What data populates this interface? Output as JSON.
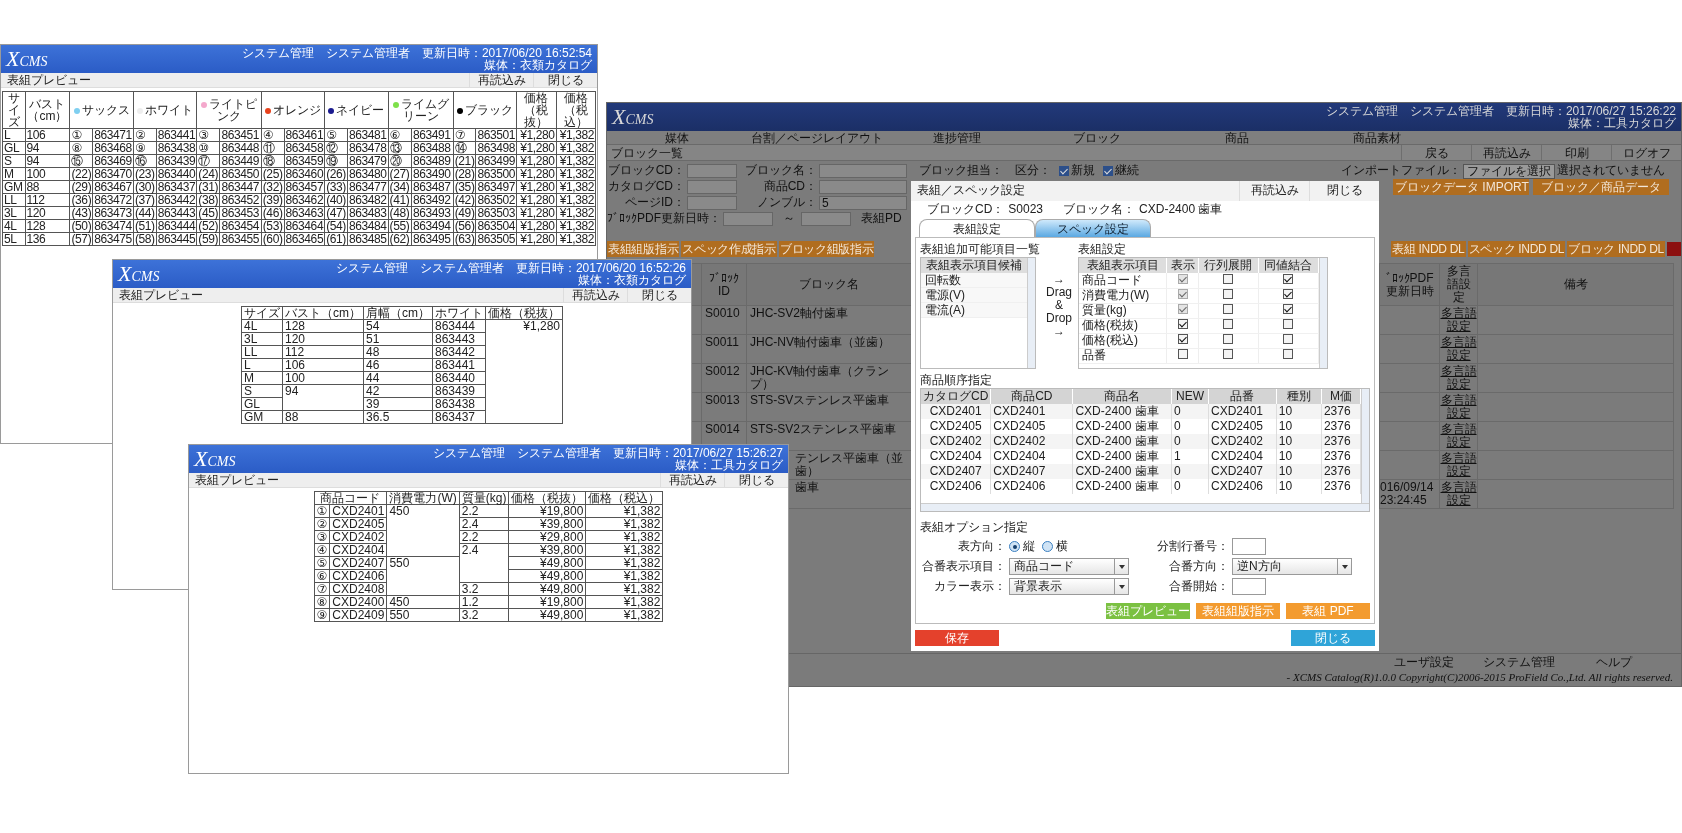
{
  "preview_windows": [
    {
      "logo": "XCMS",
      "header_info": "システム管理　システム管理者　更新日時：2017/06/20 16:52:54",
      "media": "媒体：衣類カタログ",
      "title": "表組プレビュー",
      "buttons": [
        "再読込み",
        "閉じる"
      ],
      "table": {
        "header": [
          {
            "text": "サイズ",
            "kind": "plain"
          },
          {
            "text": "バスト（cm）",
            "kind": "plain"
          },
          {
            "text": "サックス",
            "color": "#7fcff0",
            "kind": "marked"
          },
          {
            "text": "ホワイト",
            "color": "#eeeeee",
            "kind": "marked"
          },
          {
            "text": "ライトピンク",
            "color": "#f4a8cc",
            "kind": "marked"
          },
          {
            "text": "オレンジ",
            "color": "#e8421c",
            "kind": "marked"
          },
          {
            "text": "ネイビー",
            "color": "#1b1b8f",
            "kind": "marked"
          },
          {
            "text": "ライムグリーン",
            "color": "#7ee04a",
            "kind": "marked"
          },
          {
            "text": "ブラック",
            "color": "#000000",
            "kind": "marked"
          },
          {
            "text": "価格（税抜）",
            "kind": "price"
          },
          {
            "text": "価格（税込）",
            "kind": "price"
          }
        ],
        "rows": [
          [
            "L",
            "106",
            "①",
            "863471",
            "②",
            "863441",
            "③",
            "863451",
            "④",
            "863461",
            "⑤",
            "863481",
            "⑥",
            "863491",
            "⑦",
            "863501",
            "¥1,280",
            "¥1,382"
          ],
          [
            "GL",
            "94",
            "⑧",
            "863468",
            "⑨",
            "863438",
            "⑩",
            "863448",
            "⑪",
            "863458",
            "⑫",
            "863478",
            "⑬",
            "863488",
            "⑭",
            "863498",
            "¥1,280",
            "¥1,382"
          ],
          [
            "S",
            "94",
            "⑮",
            "863469",
            "⑯",
            "863439",
            "⑰",
            "863449",
            "⑱",
            "863459",
            "⑲",
            "863479",
            "⑳",
            "863489",
            "(21)",
            "863499",
            "¥1,280",
            "¥1,382"
          ],
          [
            "M",
            "100",
            "(22)",
            "863470",
            "(23)",
            "863440",
            "(24)",
            "863450",
            "(25)",
            "863460",
            "(26)",
            "863480",
            "(27)",
            "863490",
            "(28)",
            "863500",
            "¥1,280",
            "¥1,382"
          ],
          [
            "GM",
            "88",
            "(29)",
            "863467",
            "(30)",
            "863437",
            "(31)",
            "863447",
            "(32)",
            "863457",
            "(33)",
            "863477",
            "(34)",
            "863487",
            "(35)",
            "863497",
            "¥1,280",
            "¥1,382"
          ],
          [
            "LL",
            "112",
            "(36)",
            "863472",
            "(37)",
            "863442",
            "(38)",
            "863452",
            "(39)",
            "863462",
            "(40)",
            "863482",
            "(41)",
            "863492",
            "(42)",
            "863502",
            "¥1,280",
            "¥1,382"
          ],
          [
            "3L",
            "120",
            "(43)",
            "863473",
            "(44)",
            "863443",
            "(45)",
            "863453",
            "(46)",
            "863463",
            "(47)",
            "863483",
            "(48)",
            "863493",
            "(49)",
            "863503",
            "¥1,280",
            "¥1,382"
          ],
          [
            "4L",
            "128",
            "(50)",
            "863474",
            "(51)",
            "863444",
            "(52)",
            "863454",
            "(53)",
            "863464",
            "(54)",
            "863484",
            "(55)",
            "863494",
            "(56)",
            "863504",
            "¥1,280",
            "¥1,382"
          ],
          [
            "5L",
            "136",
            "(57)",
            "863475",
            "(58)",
            "863445",
            "(59)",
            "863455",
            "(60)",
            "863465",
            "(61)",
            "863485",
            "(62)",
            "863495",
            "(63)",
            "863505",
            "¥1,280",
            "¥1,382"
          ]
        ]
      }
    },
    {
      "logo": "XCMS",
      "header_info": "システム管理　システム管理者　更新日時：2017/06/20 16:52:26",
      "media": "媒体：衣類カタログ",
      "title": "表組プレビュー",
      "buttons": [
        "再読込み",
        "閉じる"
      ],
      "table": {
        "header": [
          {
            "text": "サイズ",
            "kind": "plain"
          },
          {
            "text": "バスト（cm）",
            "kind": "plain"
          },
          {
            "text": "肩幅（cm）",
            "kind": "plain"
          },
          {
            "text": "ホワイト",
            "kind": "plain"
          },
          {
            "text": "価格（税抜）",
            "kind": "price"
          }
        ],
        "rows": [
          [
            "4L",
            "128",
            "54",
            "863444",
            "¥1,280"
          ],
          [
            "3L",
            "120",
            "51",
            "863443",
            null
          ],
          [
            "LL",
            "112",
            "48",
            "863442",
            null
          ],
          [
            "L",
            "106",
            "46",
            "863441",
            null
          ],
          [
            "M",
            "100",
            "44",
            "863440",
            null
          ],
          [
            "S",
            "94",
            "42",
            "863439",
            null
          ],
          [
            "GL",
            null,
            "39",
            "863438",
            null
          ],
          [
            "GM",
            "88",
            "36.5",
            "863437",
            null
          ]
        ]
      }
    },
    {
      "logo": "XCMS",
      "header_info": "システム管理　システム管理者　更新日時：2017/06/27 15:26:27",
      "media": "媒体：工具カタログ",
      "title": "表組プレビュー",
      "buttons": [
        "再読込み",
        "閉じる"
      ],
      "table": {
        "header": [
          {
            "text": "商品コード",
            "kind": "marked"
          },
          {
            "text": "消費電力(W)",
            "kind": "plain"
          },
          {
            "text": "質量(kg)",
            "kind": "plain"
          },
          {
            "text": "価格（税抜）",
            "kind": "price"
          },
          {
            "text": "価格（税込）",
            "kind": "price"
          }
        ],
        "rows": [
          [
            "①",
            "CXD2401",
            "450",
            "2.2",
            "¥19,800",
            "¥1,382"
          ],
          [
            "②",
            "CXD2405",
            null,
            "2.4",
            "¥39,800",
            "¥1,382"
          ],
          [
            "③",
            "CXD2402",
            null,
            "2.2",
            "¥29,800",
            "¥1,382"
          ],
          [
            "④",
            "CXD2404",
            null,
            "2.4",
            "¥39,800",
            "¥1,382"
          ],
          [
            "⑤",
            "CXD2407",
            "550",
            null,
            "¥49,800",
            "¥1,382"
          ],
          [
            "⑥",
            "CXD2406",
            null,
            null,
            "¥49,800",
            "¥1,382"
          ],
          [
            "⑦",
            "CXD2408",
            null,
            "3.2",
            "¥49,800",
            "¥1,382"
          ],
          [
            "⑧",
            "CXD2400",
            "450",
            "1.2",
            "¥19,800",
            "¥1,382"
          ],
          [
            "⑨",
            "CXD2409",
            "550",
            "3.2",
            "¥49,800",
            "¥1,382"
          ]
        ]
      }
    }
  ],
  "main_window": {
    "logo": "XCMS",
    "header_info": "システム管理　システム管理者　更新日時：2017/06/27 15:26:22",
    "media": "媒体：工具カタログ",
    "nav": [
      "媒体",
      "台割／ページレイアウト",
      "進捗管理",
      "ブロック",
      "商品",
      "商品素材"
    ],
    "page_title": "ブロック一覧",
    "actions": [
      "戻る",
      "再読込み",
      "印刷",
      "ログオフ"
    ],
    "search_rows": [
      [
        {
          "kind": "field",
          "label": "ブロックCD："
        },
        {
          "kind": "long_field",
          "label": "ブロック名："
        },
        {
          "kind": "label",
          "label": "ブロック担当："
        },
        {
          "kind": "label",
          "label": "区分："
        },
        {
          "kind": "check",
          "label": "新規",
          "checked": true
        },
        {
          "kind": "check",
          "label": "継続",
          "checked": true
        },
        {
          "kind": "file",
          "label": "インポートファイル：",
          "button": "ファイルを選択",
          "note": "選択されていません"
        }
      ],
      [
        {
          "kind": "field",
          "label": "カタログCD："
        },
        {
          "kind": "long_field",
          "label": "商品CD："
        },
        {
          "kind": "action",
          "label": "ブロックデータ IMPORT"
        },
        {
          "kind": "action",
          "label": "ブロック／商品データ"
        }
      ],
      [
        {
          "kind": "field",
          "label": "ページID："
        },
        {
          "kind": "long_field",
          "label": "ノンブル：",
          "value": "5"
        }
      ],
      [
        {
          "kind": "field",
          "label": "ﾌﾞﾛｯｸPDF更新日時："
        },
        {
          "kind": "label",
          "label": "～"
        },
        {
          "kind": "field"
        },
        {
          "kind": "label",
          "label": "表組PD"
        }
      ]
    ],
    "left_buttons": [
      "表組組版指示",
      "スペック作成指示",
      "ブロック組版指示"
    ],
    "right_buttons": [
      "表組 INDD DL",
      "スペック INDD DL",
      "ブロック INDD DL"
    ],
    "table": {
      "columns": [
        "ﾌﾞﾛｯｸID",
        "ブロック名",
        "ﾞﾛｯｸPDF更新日時",
        "多言語設定",
        "備考"
      ],
      "rows": [
        {
          "id": "S0010",
          "name": "JHC-SV2軸付歯車",
          "partly_hidden": false,
          "lang": "多言語設定"
        },
        {
          "id": "S0011",
          "name": "JHC-NV軸付歯車（並歯）",
          "partly_hidden": false,
          "lang": "多言語設定"
        },
        {
          "id": "S0012",
          "name": "JHC-KV軸付歯車（クランプ）",
          "partly_hidden": false,
          "lang": "多言語設定"
        },
        {
          "id": "S0013",
          "name": "STS-SVステンレス平歯車",
          "partly_hidden": false,
          "lang": "多言語設定"
        },
        {
          "id": "S0014",
          "name": "STS-SV2ステンレス平歯車",
          "partly_hidden": false,
          "lang": "多言語設定"
        },
        {
          "name": "テンレス平歯車（並歯）",
          "partly_hidden": true,
          "lang": "多言語設定"
        },
        {
          "name": "歯車",
          "partly_hidden": true,
          "pdf_date": "016/09/14 23:24:45",
          "lang": "多言語設定"
        }
      ]
    },
    "footer_links": [
      "ユーザ設定",
      "システム管理",
      "ヘルプ"
    ],
    "copyright": "- XCMS Catalog(R)1.0.0  Copyright(C)2006-2015 ProField Co.,Ltd. All rights reserved."
  },
  "dialog": {
    "title": "表組／スペック設定",
    "header_buttons": [
      "再読込み",
      "閉じる"
    ],
    "info": [
      {
        "label": "ブロックCD：",
        "value": "S0023"
      },
      {
        "label": "ブロック名：",
        "value": "CXD-2400 歯車"
      }
    ],
    "tabs": [
      {
        "label": "表組設定",
        "selected": true
      },
      {
        "label": "スペック設定",
        "selected": false
      }
    ],
    "candidates": {
      "title": "表組追加可能項目一覧",
      "header": "表組表示項目候補",
      "items": [
        "回転数",
        "電源(V)",
        "電流(A)"
      ]
    },
    "drag_hint": "→ Drag & Drop →",
    "layout": {
      "title": "表組設定",
      "columns": [
        "表組表示項目",
        "表示",
        "行列展開",
        "同値結合"
      ],
      "rows": [
        {
          "item": "商品コード",
          "checks": [
            {
              "checked": true,
              "disabled": true
            },
            {
              "checked": false,
              "disabled": false
            },
            {
              "checked": true,
              "disabled": false
            }
          ]
        },
        {
          "item": "消費電力(W)",
          "checks": [
            {
              "checked": true,
              "disabled": true
            },
            {
              "checked": false,
              "disabled": false
            },
            {
              "checked": true,
              "disabled": false
            }
          ]
        },
        {
          "item": "質量(kg)",
          "checks": [
            {
              "checked": true,
              "disabled": true
            },
            {
              "checked": false,
              "disabled": false
            },
            {
              "checked": true,
              "disabled": false
            }
          ]
        },
        {
          "item": "価格(税抜)",
          "checks": [
            {
              "checked": true,
              "disabled": false
            },
            {
              "checked": false,
              "disabled": false
            },
            {
              "checked": false,
              "disabled": false
            }
          ]
        },
        {
          "item": "価格(税込)",
          "checks": [
            {
              "checked": true,
              "disabled": false
            },
            {
              "checked": false,
              "disabled": false
            },
            {
              "checked": false,
              "disabled": false
            }
          ]
        },
        {
          "item": "品番",
          "checks": [
            {
              "checked": false,
              "disabled": false
            },
            {
              "checked": false,
              "disabled": false
            },
            {
              "checked": false,
              "disabled": false
            }
          ]
        }
      ]
    },
    "order": {
      "title": "商品順序指定",
      "columns": [
        "カタログCD",
        "商品CD",
        "商品名",
        "NEW",
        "品番",
        "種別",
        "M価"
      ],
      "rows": [
        [
          "CXD2401",
          "CXD2401",
          "CXD-2400 歯車",
          "0",
          "CXD2401",
          "10",
          "2376"
        ],
        [
          "CXD2405",
          "CXD2405",
          "CXD-2400 歯車",
          "0",
          "CXD2405",
          "10",
          "2376"
        ],
        [
          "CXD2402",
          "CXD2402",
          "CXD-2400 歯車",
          "0",
          "CXD2402",
          "10",
          "2376"
        ],
        [
          "CXD2404",
          "CXD2404",
          "CXD-2400 歯車",
          "1",
          "CXD2404",
          "10",
          "2376"
        ],
        [
          "CXD2407",
          "CXD2407",
          "CXD-2400 歯車",
          "0",
          "CXD2407",
          "10",
          "2376"
        ],
        [
          "CXD2406",
          "CXD2406",
          "CXD-2400 歯車",
          "0",
          "CXD2406",
          "10",
          "2376"
        ]
      ]
    },
    "options": {
      "title": "表組オプション指定",
      "direction": {
        "label": "表方向：",
        "choices": [
          {
            "label": "縦",
            "selected": true
          },
          {
            "label": "横",
            "selected": false
          }
        ]
      },
      "split": {
        "label": "分割行番号："
      },
      "number_item": {
        "label": "合番表示項目：",
        "value": "商品コード"
      },
      "number_dir": {
        "label": "合番方向：",
        "value": "逆N方向"
      },
      "color_mode": {
        "label": "カラー表示：",
        "value": "背景表示"
      },
      "number_start": {
        "label": "合番開始："
      }
    },
    "actions": [
      {
        "label": "表組プレビュー",
        "kind": "preview"
      },
      {
        "label": "表組組版指示",
        "kind": "typeset"
      },
      {
        "label": "表組 PDF",
        "kind": "pdf"
      }
    ],
    "footer": [
      {
        "label": "保存",
        "kind": "save"
      },
      {
        "label": "閉じる",
        "kind": "close"
      }
    ]
  }
}
